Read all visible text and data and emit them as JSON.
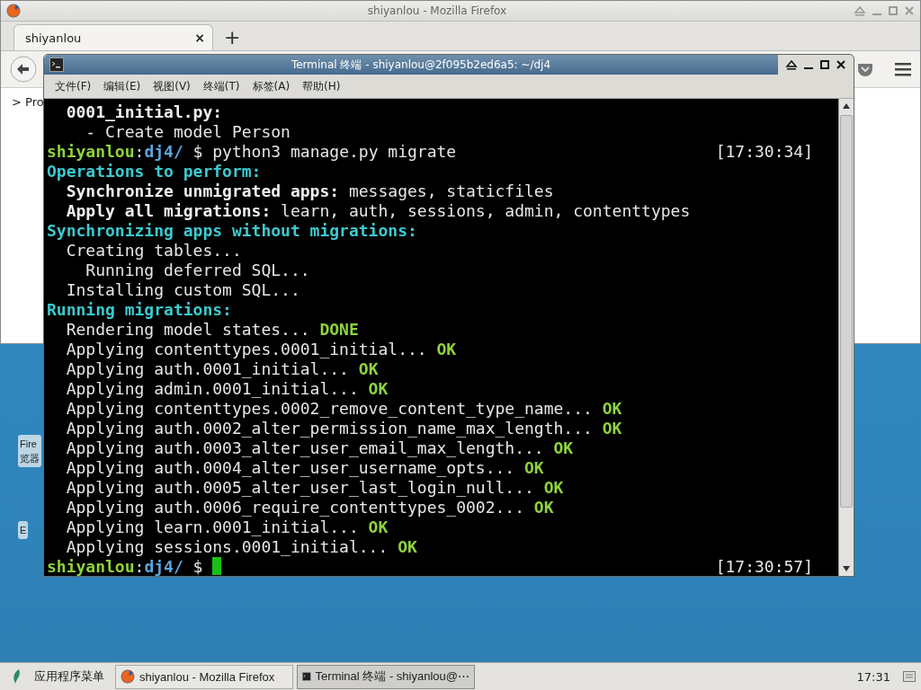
{
  "browser_window": {
    "title": "shiyanlou - Mozilla Firefox",
    "tabs": [
      {
        "label": "shiyanlou",
        "close": "×",
        "selected": true
      }
    ],
    "new_tab": "+",
    "page_text": "> Pro"
  },
  "desktop_icons": [
    {
      "lines": [
        "Fire",
        "览器"
      ]
    },
    {
      "lines": [
        "E"
      ]
    }
  ],
  "terminal_window": {
    "title": "Terminal 终端 - shiyanlou@2f095b2ed6a5: ~/dj4",
    "menu": [
      "文件(F)",
      "编辑(E)",
      "视图(V)",
      "终端(T)",
      "标签(A)",
      "帮助(H)"
    ],
    "lines": [
      {
        "segments": [
          {
            "kind": "bold",
            "text": "  0001_initial.py:"
          }
        ]
      },
      {
        "segments": [
          {
            "kind": "plain",
            "text": "    - Create model Person"
          }
        ]
      },
      {
        "segments": [
          {
            "kind": "user",
            "text": "shiyanlou"
          },
          {
            "kind": "plain",
            "text": ":"
          },
          {
            "kind": "path",
            "text": "dj4/"
          },
          {
            "kind": "plain",
            "text": " $ python3 manage.py migrate"
          }
        ],
        "time": "[17:30:34]"
      },
      {
        "segments": [
          {
            "kind": "heading",
            "text": "Operations to perform:"
          }
        ]
      },
      {
        "segments": [
          {
            "kind": "bold",
            "text": "  Synchronize unmigrated apps:"
          },
          {
            "kind": "plain",
            "text": " messages, staticfiles"
          }
        ]
      },
      {
        "segments": [
          {
            "kind": "bold",
            "text": "  Apply all migrations:"
          },
          {
            "kind": "plain",
            "text": " learn, auth, sessions, admin, contenttypes"
          }
        ]
      },
      {
        "segments": [
          {
            "kind": "heading",
            "text": "Synchronizing apps without migrations:"
          }
        ]
      },
      {
        "segments": [
          {
            "kind": "plain",
            "text": "  Creating tables..."
          }
        ]
      },
      {
        "segments": [
          {
            "kind": "plain",
            "text": "    Running deferred SQL..."
          }
        ]
      },
      {
        "segments": [
          {
            "kind": "plain",
            "text": "  Installing custom SQL..."
          }
        ]
      },
      {
        "segments": [
          {
            "kind": "heading",
            "text": "Running migrations:"
          }
        ]
      },
      {
        "segments": [
          {
            "kind": "plain",
            "text": "  Rendering model states..."
          },
          {
            "kind": "ok",
            "text": " DONE"
          }
        ]
      },
      {
        "segments": [
          {
            "kind": "plain",
            "text": "  Applying contenttypes.0001_initial..."
          },
          {
            "kind": "ok",
            "text": " OK"
          }
        ]
      },
      {
        "segments": [
          {
            "kind": "plain",
            "text": "  Applying auth.0001_initial..."
          },
          {
            "kind": "ok",
            "text": " OK"
          }
        ]
      },
      {
        "segments": [
          {
            "kind": "plain",
            "text": "  Applying admin.0001_initial..."
          },
          {
            "kind": "ok",
            "text": " OK"
          }
        ]
      },
      {
        "segments": [
          {
            "kind": "plain",
            "text": "  Applying contenttypes.0002_remove_content_type_name..."
          },
          {
            "kind": "ok",
            "text": " OK"
          }
        ]
      },
      {
        "segments": [
          {
            "kind": "plain",
            "text": "  Applying auth.0002_alter_permission_name_max_length..."
          },
          {
            "kind": "ok",
            "text": " OK"
          }
        ]
      },
      {
        "segments": [
          {
            "kind": "plain",
            "text": "  Applying auth.0003_alter_user_email_max_length..."
          },
          {
            "kind": "ok",
            "text": " OK"
          }
        ]
      },
      {
        "segments": [
          {
            "kind": "plain",
            "text": "  Applying auth.0004_alter_user_username_opts..."
          },
          {
            "kind": "ok",
            "text": " OK"
          }
        ]
      },
      {
        "segments": [
          {
            "kind": "plain",
            "text": "  Applying auth.0005_alter_user_last_login_null..."
          },
          {
            "kind": "ok",
            "text": " OK"
          }
        ]
      },
      {
        "segments": [
          {
            "kind": "plain",
            "text": "  Applying auth.0006_require_contenttypes_0002..."
          },
          {
            "kind": "ok",
            "text": " OK"
          }
        ]
      },
      {
        "segments": [
          {
            "kind": "plain",
            "text": "  Applying learn.0001_initial..."
          },
          {
            "kind": "ok",
            "text": " OK"
          }
        ]
      },
      {
        "segments": [
          {
            "kind": "plain",
            "text": "  Applying sessions.0001_initial..."
          },
          {
            "kind": "ok",
            "text": " OK"
          }
        ]
      },
      {
        "segments": [
          {
            "kind": "user",
            "text": "shiyanlou"
          },
          {
            "kind": "plain",
            "text": ":"
          },
          {
            "kind": "path",
            "text": "dj4/"
          },
          {
            "kind": "plain",
            "text": " $ "
          }
        ],
        "time": "[17:30:57]",
        "cursor": true
      }
    ]
  },
  "taskbar": {
    "menu_label": "应用程序菜单",
    "tasks": [
      {
        "kind": "firefox",
        "label": "shiyanlou - Mozilla Firefox",
        "selected": false
      },
      {
        "kind": "terminal",
        "label": "Terminal 终端 - shiyanlou@⋯",
        "selected": true
      }
    ],
    "clock": "17:31"
  }
}
